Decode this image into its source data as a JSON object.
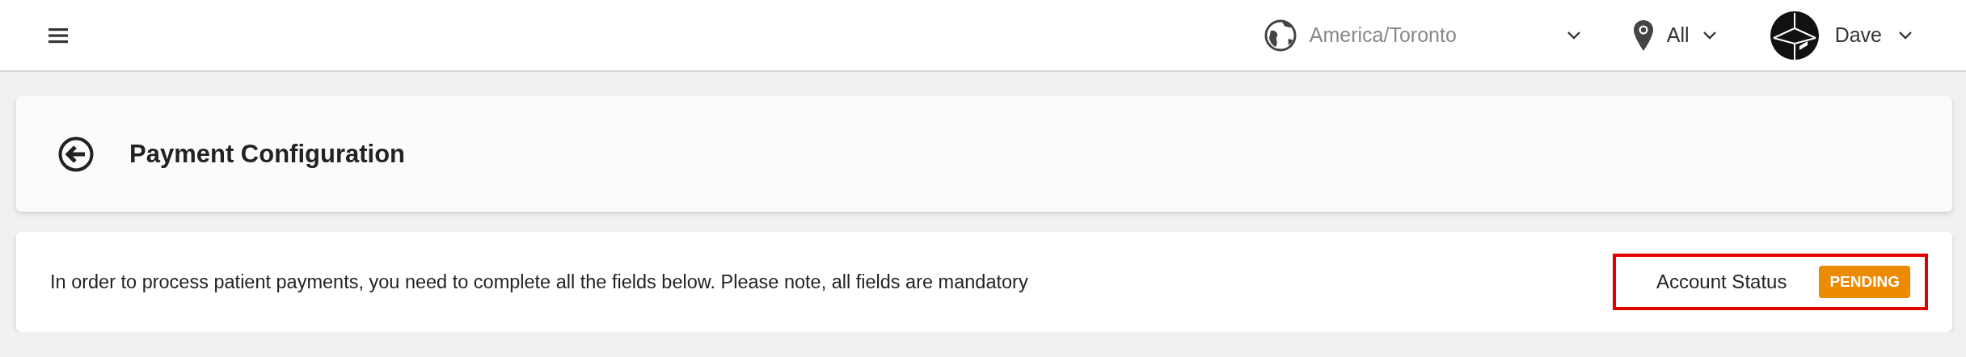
{
  "topbar": {
    "timezone": "America/Toronto",
    "location": "All",
    "user": "Dave"
  },
  "page_header": {
    "title": "Payment Configuration"
  },
  "notice": {
    "text": "In order to process patient payments, you need to complete all the fields below. Please note, all fields are mandatory",
    "status_label": "Account Status",
    "status": {
      "text": "PENDING",
      "kind": "pending"
    },
    "highlighted": true
  }
}
